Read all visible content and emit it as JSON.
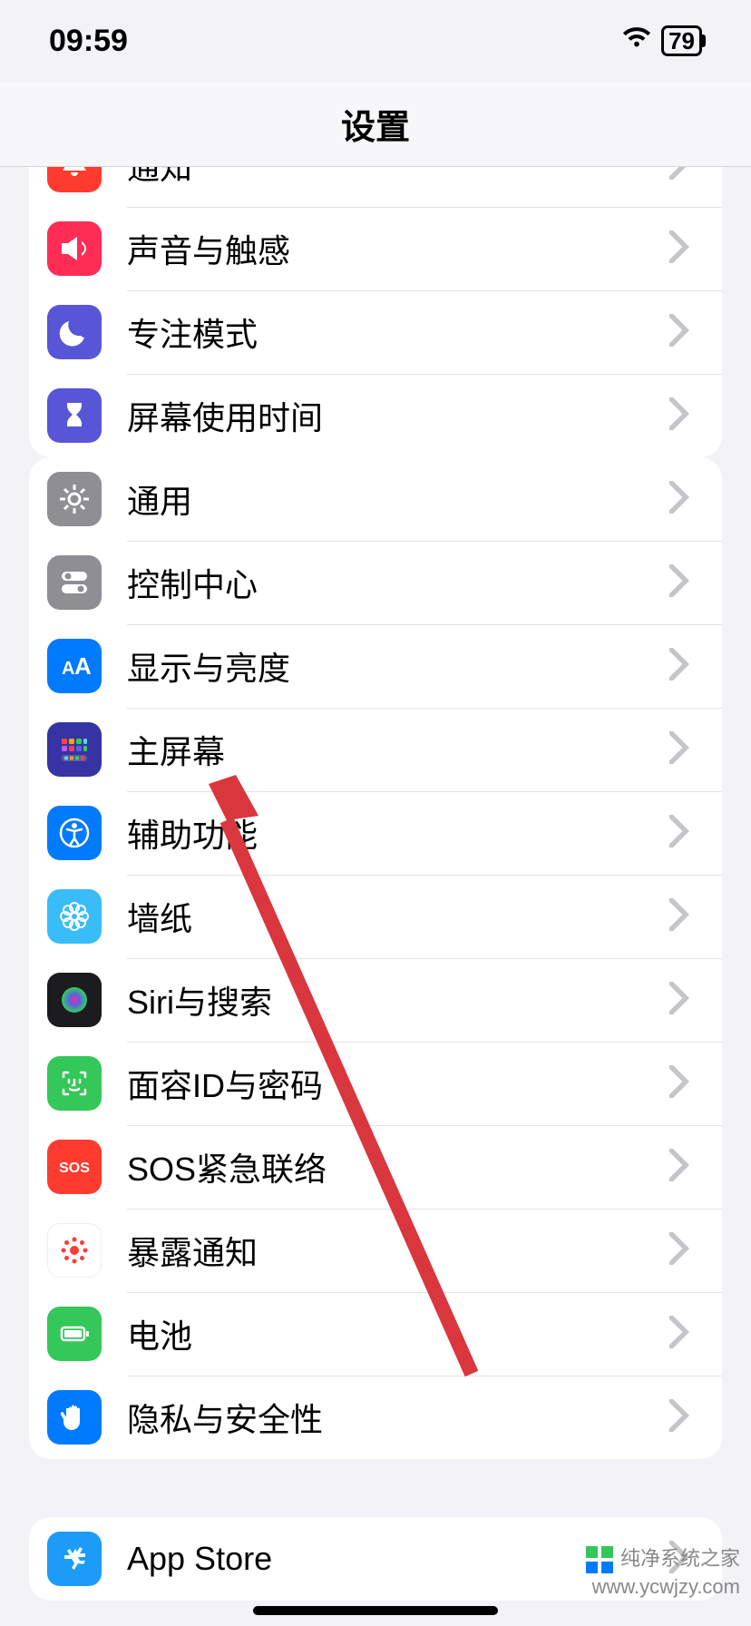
{
  "status": {
    "time": "09:59",
    "battery": "79"
  },
  "header": {
    "title": "设置"
  },
  "group1": [
    {
      "label": "通知"
    },
    {
      "label": "声音与触感"
    },
    {
      "label": "专注模式"
    },
    {
      "label": "屏幕使用时间"
    }
  ],
  "group2": [
    {
      "label": "通用"
    },
    {
      "label": "控制中心"
    },
    {
      "label": "显示与亮度"
    },
    {
      "label": "主屏幕"
    },
    {
      "label": "辅助功能"
    },
    {
      "label": "墙纸"
    },
    {
      "label": "Siri与搜索"
    },
    {
      "label": "面容ID与密码"
    },
    {
      "label": "SOS紧急联络"
    },
    {
      "label": "暴露通知"
    },
    {
      "label": "电池"
    },
    {
      "label": "隐私与安全性"
    }
  ],
  "group3": [
    {
      "label": "App Store"
    }
  ],
  "watermark": {
    "line1": "纯净系统之家",
    "line2": "www.ycwjzy.com"
  }
}
